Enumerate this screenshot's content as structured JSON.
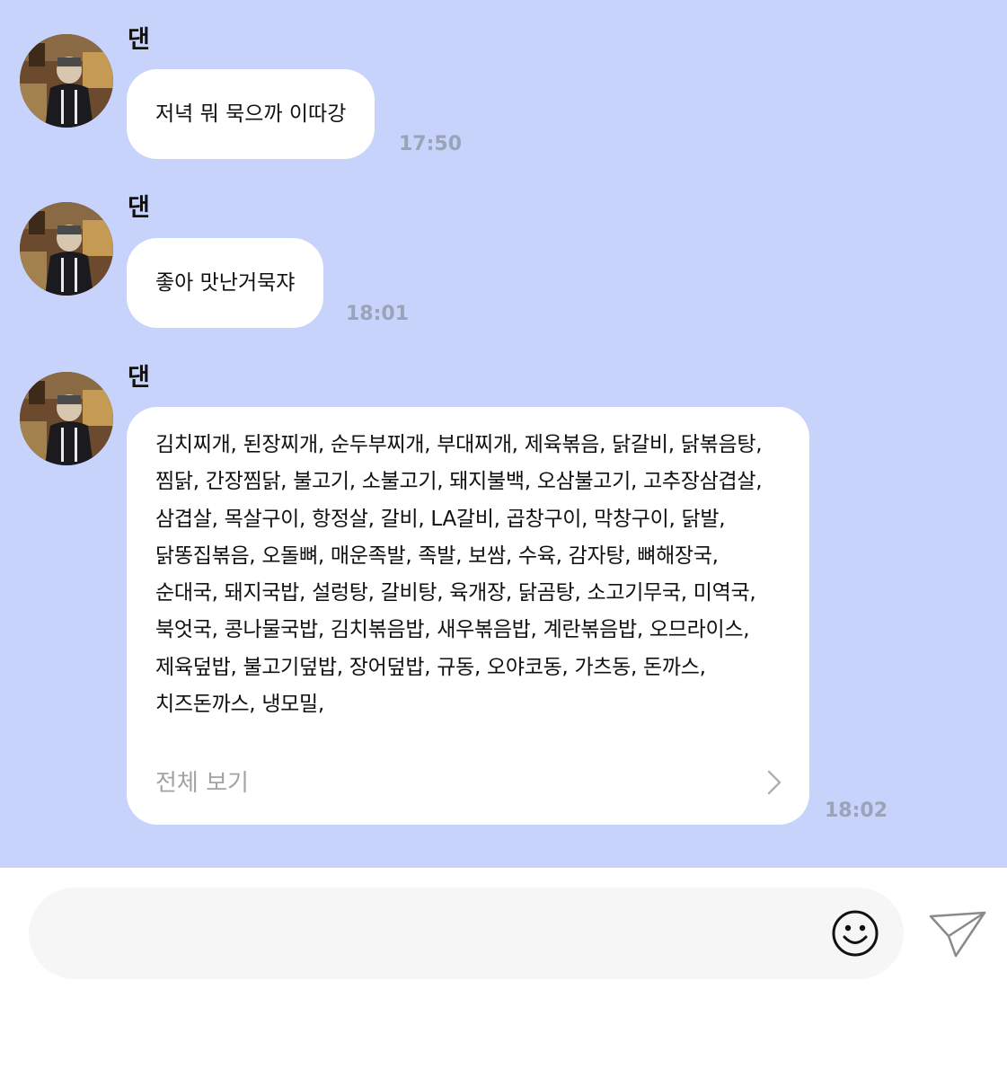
{
  "messages": [
    {
      "sender": "댄",
      "text": "저녁 뭐 묵으까 이따강",
      "time": "17:50"
    },
    {
      "sender": "댄",
      "text": "좋아 맛난거묵쟈",
      "time": "18:01"
    },
    {
      "sender": "댄",
      "text": "김치찌개, 된장찌개, 순두부찌개, 부대찌개, 제육볶음, 닭갈비, 닭볶음탕, 찜닭, 간장찜닭, 불고기, 소불고기, 돼지불백, 오삼불고기, 고추장삼겹살, 삼겹살, 목살구이, 항정살, 갈비, LA갈비, 곱창구이, 막창구이, 닭발, 닭똥집볶음, 오돌뼈, 매운족발, 족발, 보쌈, 수육, 감자탕, 뼈해장국, 순대국, 돼지국밥, 설렁탕, 갈비탕, 육개장, 닭곰탕, 소고기무국, 미역국, 북엇국, 콩나물국밥, 김치볶음밥, 새우볶음밥, 계란볶음밥, 오므라이스, 제육덮밥, 불고기덮밥, 장어덮밥, 규동, 오야코동, 가츠동, 돈까스, 치즈돈까스, 냉모밀,",
      "view_all_label": "전체 보기",
      "time": "18:02"
    }
  ],
  "input": {
    "placeholder": ""
  },
  "icons": {
    "emoji": "smiley-icon",
    "send": "paper-plane-icon",
    "view_all": "chevron-right-icon"
  },
  "colors": {
    "chat_background": "#c7d3fb",
    "bubble": "#ffffff",
    "timestamp": "#9aa3b8",
    "input_background": "#f6f6f6"
  }
}
